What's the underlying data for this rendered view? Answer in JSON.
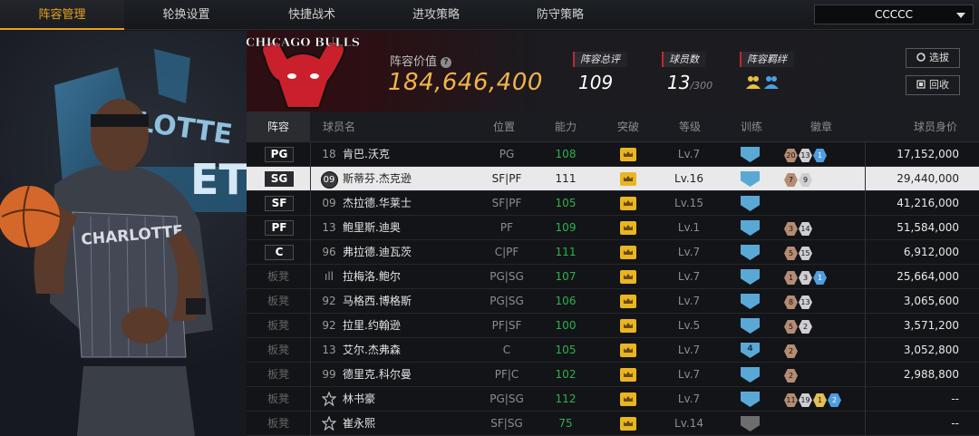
{
  "tabs": [
    "阵容管理",
    "轮换设置",
    "快捷战术",
    "进攻策略",
    "防守策略"
  ],
  "team_select": "CCCCC",
  "logo_text": "CHICAGO BULLS",
  "art_text": "CHARLOTTE",
  "art_backdrop": "LOTTE",
  "art_backdrop2": "ET",
  "lineup_value_label": "阵容价值",
  "lineup_value": "184,646,400",
  "stats": {
    "rating_label": "阵容总评",
    "rating": "109",
    "players_label": "球员数",
    "players": "13",
    "players_max": "/300",
    "chem_label": "阵容羁绊"
  },
  "buttons": {
    "select": "选拔",
    "recycle": "回收"
  },
  "columns": [
    "阵容",
    "球员名",
    "位置",
    "能力",
    "突破",
    "等级",
    "训练",
    "徽章",
    "球员身价"
  ],
  "rows": [
    {
      "slot": "PG",
      "num": "18",
      "name": "肯巴.沃克",
      "pos": "PG",
      "abil": "108",
      "lv": "Lv.7",
      "train": "",
      "badges": [
        [
          "b-br",
          "20"
        ],
        [
          "b-si",
          "13"
        ],
        [
          "b-bl",
          "1"
        ]
      ],
      "salary": "17,152,000"
    },
    {
      "slot": "SG",
      "num": "09",
      "name": "斯蒂芬.杰克逊",
      "pos": "SF|PF",
      "abil": "111",
      "lv": "Lv.16",
      "train": "",
      "badges": [
        [
          "b-br",
          "7"
        ],
        [
          "b-si",
          "9"
        ]
      ],
      "salary": "29,440,000",
      "sel": true
    },
    {
      "slot": "SF",
      "num": "09",
      "name": "杰拉德.华莱士",
      "pos": "SF|PF",
      "abil": "105",
      "lv": "Lv.15",
      "train": "",
      "badges": [],
      "salary": "41,216,000"
    },
    {
      "slot": "PF",
      "num": "13",
      "name": "鲍里斯.迪奥",
      "pos": "PF",
      "abil": "109",
      "lv": "Lv.1",
      "train": "",
      "badges": [
        [
          "b-br",
          "3"
        ],
        [
          "b-si",
          "14"
        ]
      ],
      "salary": "51,584,000"
    },
    {
      "slot": "C",
      "num": "96",
      "name": "弗拉德.迪瓦茨",
      "pos": "C|PF",
      "abil": "111",
      "lv": "Lv.7",
      "train": "",
      "badges": [
        [
          "b-br",
          "5"
        ],
        [
          "b-si",
          "15"
        ]
      ],
      "salary": "6,912,000"
    },
    {
      "slot": "板凳",
      "num": "ıll",
      "name": "拉梅洛.鲍尔",
      "pos": "PG|SG",
      "abil": "107",
      "lv": "Lv.7",
      "train": "",
      "badges": [
        [
          "b-br",
          "1"
        ],
        [
          "b-si",
          "3"
        ],
        [
          "b-bl",
          "1"
        ]
      ],
      "salary": "25,664,000"
    },
    {
      "slot": "板凳",
      "num": "92",
      "name": "马格西.博格斯",
      "pos": "PG|SG",
      "abil": "106",
      "lv": "Lv.7",
      "train": "",
      "badges": [
        [
          "b-br",
          "8"
        ],
        [
          "b-si",
          "13"
        ]
      ],
      "salary": "3,065,600"
    },
    {
      "slot": "板凳",
      "num": "92",
      "name": "拉里.约翰逊",
      "pos": "PF|SF",
      "abil": "100",
      "lv": "Lv.5",
      "train": "",
      "badges": [
        [
          "b-br",
          "5"
        ],
        [
          "b-si",
          "2"
        ]
      ],
      "salary": "3,571,200"
    },
    {
      "slot": "板凳",
      "num": "13",
      "name": "艾尔.杰弗森",
      "pos": "C",
      "abil": "105",
      "lv": "Lv.7",
      "train": "4",
      "badges": [
        [
          "b-br",
          "2"
        ]
      ],
      "salary": "3,052,800"
    },
    {
      "slot": "板凳",
      "num": "99",
      "name": "德里克.科尔曼",
      "pos": "PF|C",
      "abil": "102",
      "lv": "Lv.7",
      "train": "",
      "badges": [
        [
          "b-br",
          "2"
        ]
      ],
      "salary": "2,988,800"
    },
    {
      "slot": "板凳",
      "num": "☆",
      "name": "林书豪",
      "pos": "PG|SG",
      "abil": "112",
      "lv": "Lv.7",
      "train": "",
      "badges": [
        [
          "b-br",
          "11"
        ],
        [
          "b-si",
          "19"
        ],
        [
          "b-go",
          "1"
        ],
        [
          "b-bl",
          "2"
        ]
      ],
      "salary": "--"
    },
    {
      "slot": "板凳",
      "num": "☆",
      "name": "崔永熙",
      "pos": "SF|SG",
      "abil": "75",
      "lv": "Lv.14",
      "train": "gray",
      "badges": [],
      "salary": "--"
    }
  ]
}
